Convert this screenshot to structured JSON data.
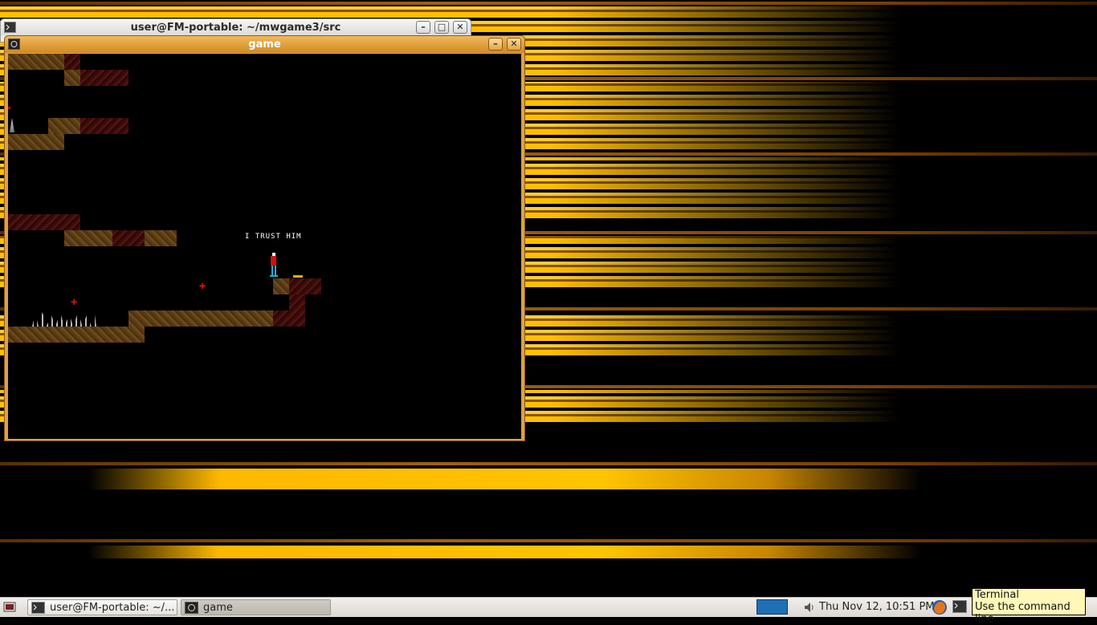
{
  "windows": {
    "terminal": {
      "title": "user@FM-portable: ~/mwgame3/src"
    },
    "game": {
      "title": "game",
      "in_game_text": "I TRUST HIM"
    }
  },
  "window_buttons": {
    "minimize": "–",
    "maximize": "□",
    "close": "✕"
  },
  "taskbar": {
    "tasks": [
      {
        "label": "user@FM-portable: ~/..."
      },
      {
        "label": "game"
      }
    ],
    "clock": "Thu Nov 12, 10:51 PM"
  },
  "tooltip": {
    "title": "Terminal",
    "description": "Use the command line"
  },
  "colors": {
    "wallpaper_gold": "#ffbf00",
    "game_title_bar": "#d08a22",
    "taskbar": "#e6e3de",
    "tooltip_bg": "#fff8b8"
  },
  "icons": [
    "terminal-icon",
    "game-app-icon",
    "volume-icon",
    "firefox-icon",
    "show-desktop-icon",
    "workspace-switcher"
  ]
}
